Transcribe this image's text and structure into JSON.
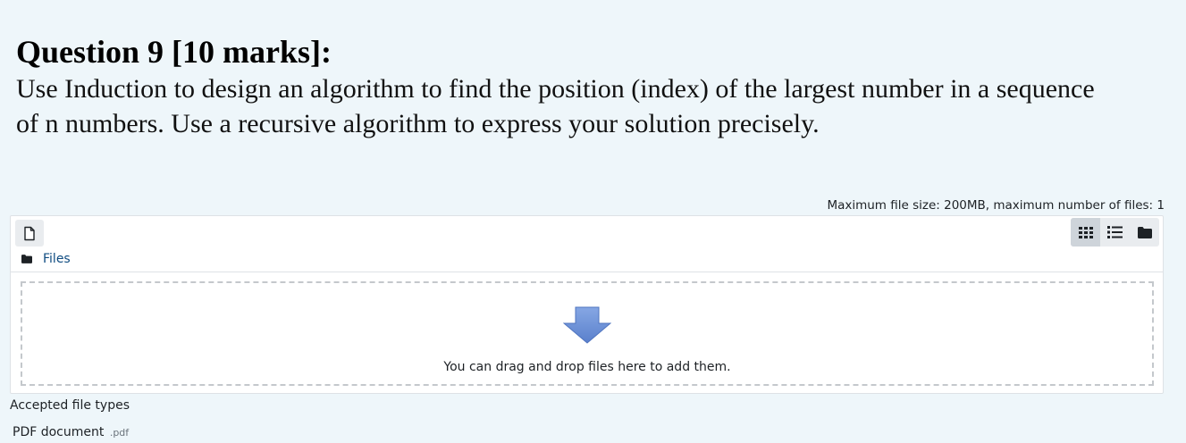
{
  "question": {
    "title": "Question 9 [10 marks]:",
    "line1": "Use Induction to design an algorithm to find the position (index) of the largest number in a sequence",
    "line2": "of n numbers. Use a recursive algorithm to express your solution precisely."
  },
  "filemanager": {
    "limits": "Maximum file size: 200MB, maximum number of files: 1",
    "breadcrumb": "Files",
    "view_modes": [
      "icons",
      "list",
      "tree"
    ],
    "active_view": "icons",
    "dropzone_text": "You can drag and drop files here to add them."
  },
  "accepted": {
    "label": "Accepted file types",
    "types": [
      {
        "name": "PDF document",
        "ext": ".pdf"
      }
    ]
  },
  "icons": {
    "add": "file-add-icon",
    "grid": "grid-view-icon",
    "list": "list-view-icon",
    "folder": "folder-icon",
    "drop": "down-arrow-icon"
  },
  "colors": {
    "background": "#eef6fa",
    "link": "#0f4c81",
    "arrow": "#6f93d6",
    "dashed_border": "#c4c8cc"
  }
}
